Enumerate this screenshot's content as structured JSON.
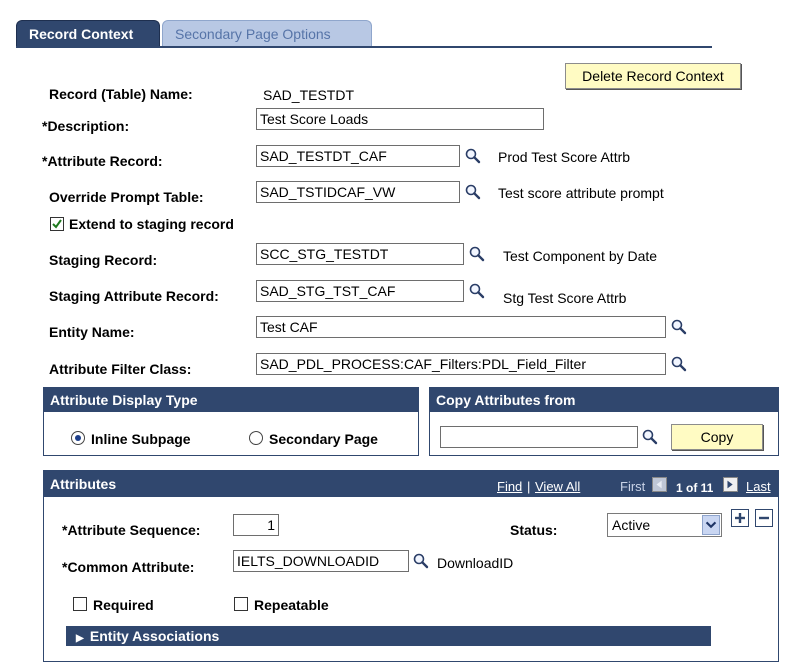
{
  "tabs": [
    {
      "label": "Record Context"
    },
    {
      "label": "Secondary Page Options"
    }
  ],
  "delete_button": "Delete Record Context",
  "fields": {
    "record_name_label": "Record (Table) Name:",
    "record_name_value": "SAD_TESTDT",
    "description_label": "*Description:",
    "description_value": "Test Score Loads",
    "attribute_record_label": "*Attribute Record:",
    "attribute_record_value": "SAD_TESTDT_CAF",
    "attribute_record_desc": "Prod Test Score Attrb",
    "override_prompt_label": "Override Prompt Table:",
    "override_prompt_value": "SAD_TSTIDCAF_VW",
    "override_prompt_desc": "Test score attribute prompt",
    "extend_label": "Extend to staging record",
    "staging_record_label": "Staging Record:",
    "staging_record_value": "SCC_STG_TESTDT",
    "staging_record_desc": "Test Component by Date",
    "staging_attr_label": "Staging Attribute Record:",
    "staging_attr_value": "SAD_STG_TST_CAF",
    "staging_attr_desc": "Stg Test Score Attrb",
    "entity_name_label": "Entity Name:",
    "entity_name_value": "Test CAF",
    "filter_class_label": "Attribute Filter Class:",
    "filter_class_value": "SAD_PDL_PROCESS:CAF_Filters:PDL_Field_Filter"
  },
  "display_type": {
    "title": "Attribute Display Type",
    "inline": "Inline Subpage",
    "secondary": "Secondary Page"
  },
  "copy_from": {
    "title": "Copy Attributes from",
    "input_value": "",
    "button": "Copy"
  },
  "attributes": {
    "title": "Attributes",
    "find": "Find",
    "sep": "|",
    "view_all": "View All",
    "first": "First",
    "count": "1 of 11",
    "last": "Last",
    "sequence_label": "*Attribute Sequence:",
    "sequence_value": "1",
    "status_label": "Status:",
    "status_value": "Active",
    "common_label": "*Common Attribute:",
    "common_value": "IELTS_DOWNLOADID",
    "common_desc": "DownloadID",
    "required_label": "Required",
    "repeatable_label": "Repeatable",
    "entity_assoc": "Entity Associations"
  },
  "colors": {
    "header_bg": "#30476e",
    "button_bg": "#fffbc3",
    "inactive_tab": "#b8c8e4"
  }
}
